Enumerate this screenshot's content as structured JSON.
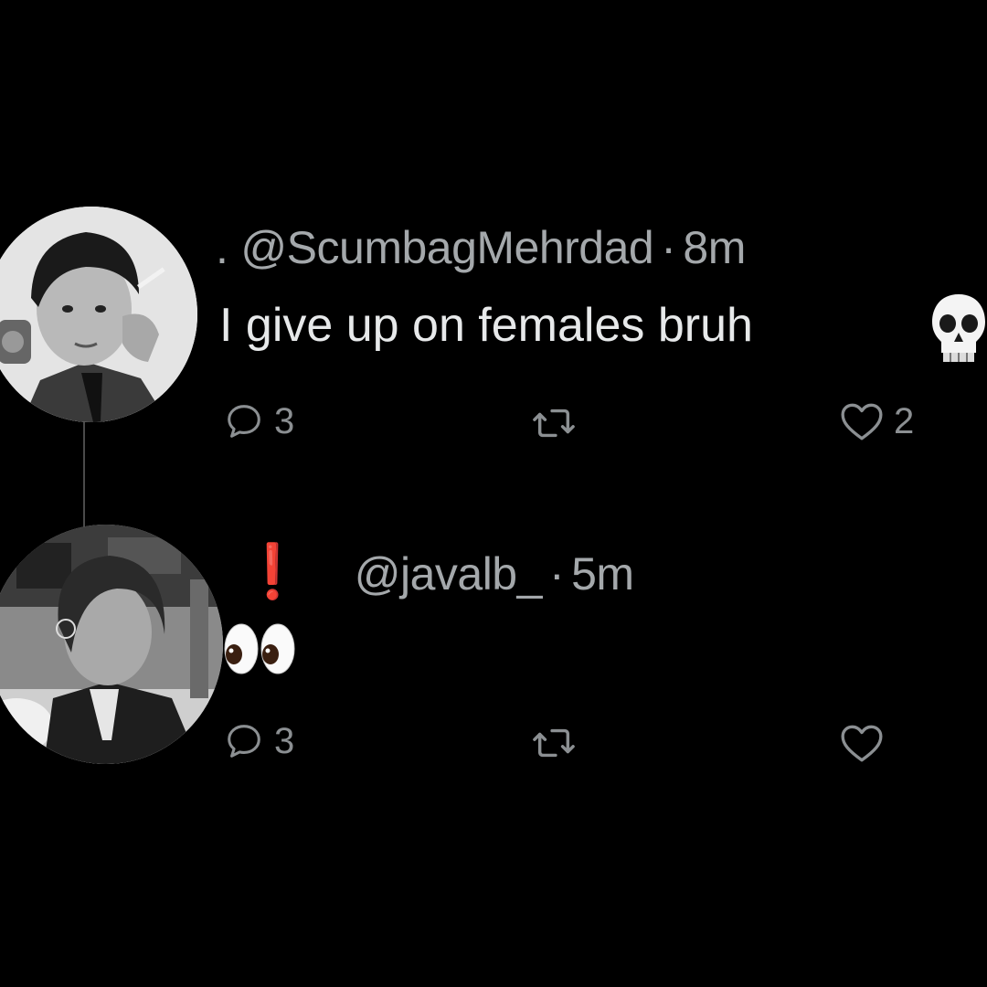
{
  "tweets": [
    {
      "prefix": ".",
      "handle": "@ScumbagMehrdad",
      "separator": "·",
      "time": "8m",
      "text": "I give up on females bruh",
      "emoji": "skull",
      "replies": "3",
      "likes": "2"
    },
    {
      "prefix": "❗",
      "handle": "@javalb_",
      "separator": "·",
      "time": "5m",
      "text": "",
      "emoji": "eyes",
      "replies": "3",
      "likes": ""
    }
  ],
  "icons": {
    "reply": "reply-icon",
    "retweet": "retweet-icon",
    "like": "heart-icon"
  },
  "colors": {
    "background": "#000000",
    "text": "#e7e9ea",
    "muted": "#8b8f92",
    "exclamation": "#e0202a"
  }
}
